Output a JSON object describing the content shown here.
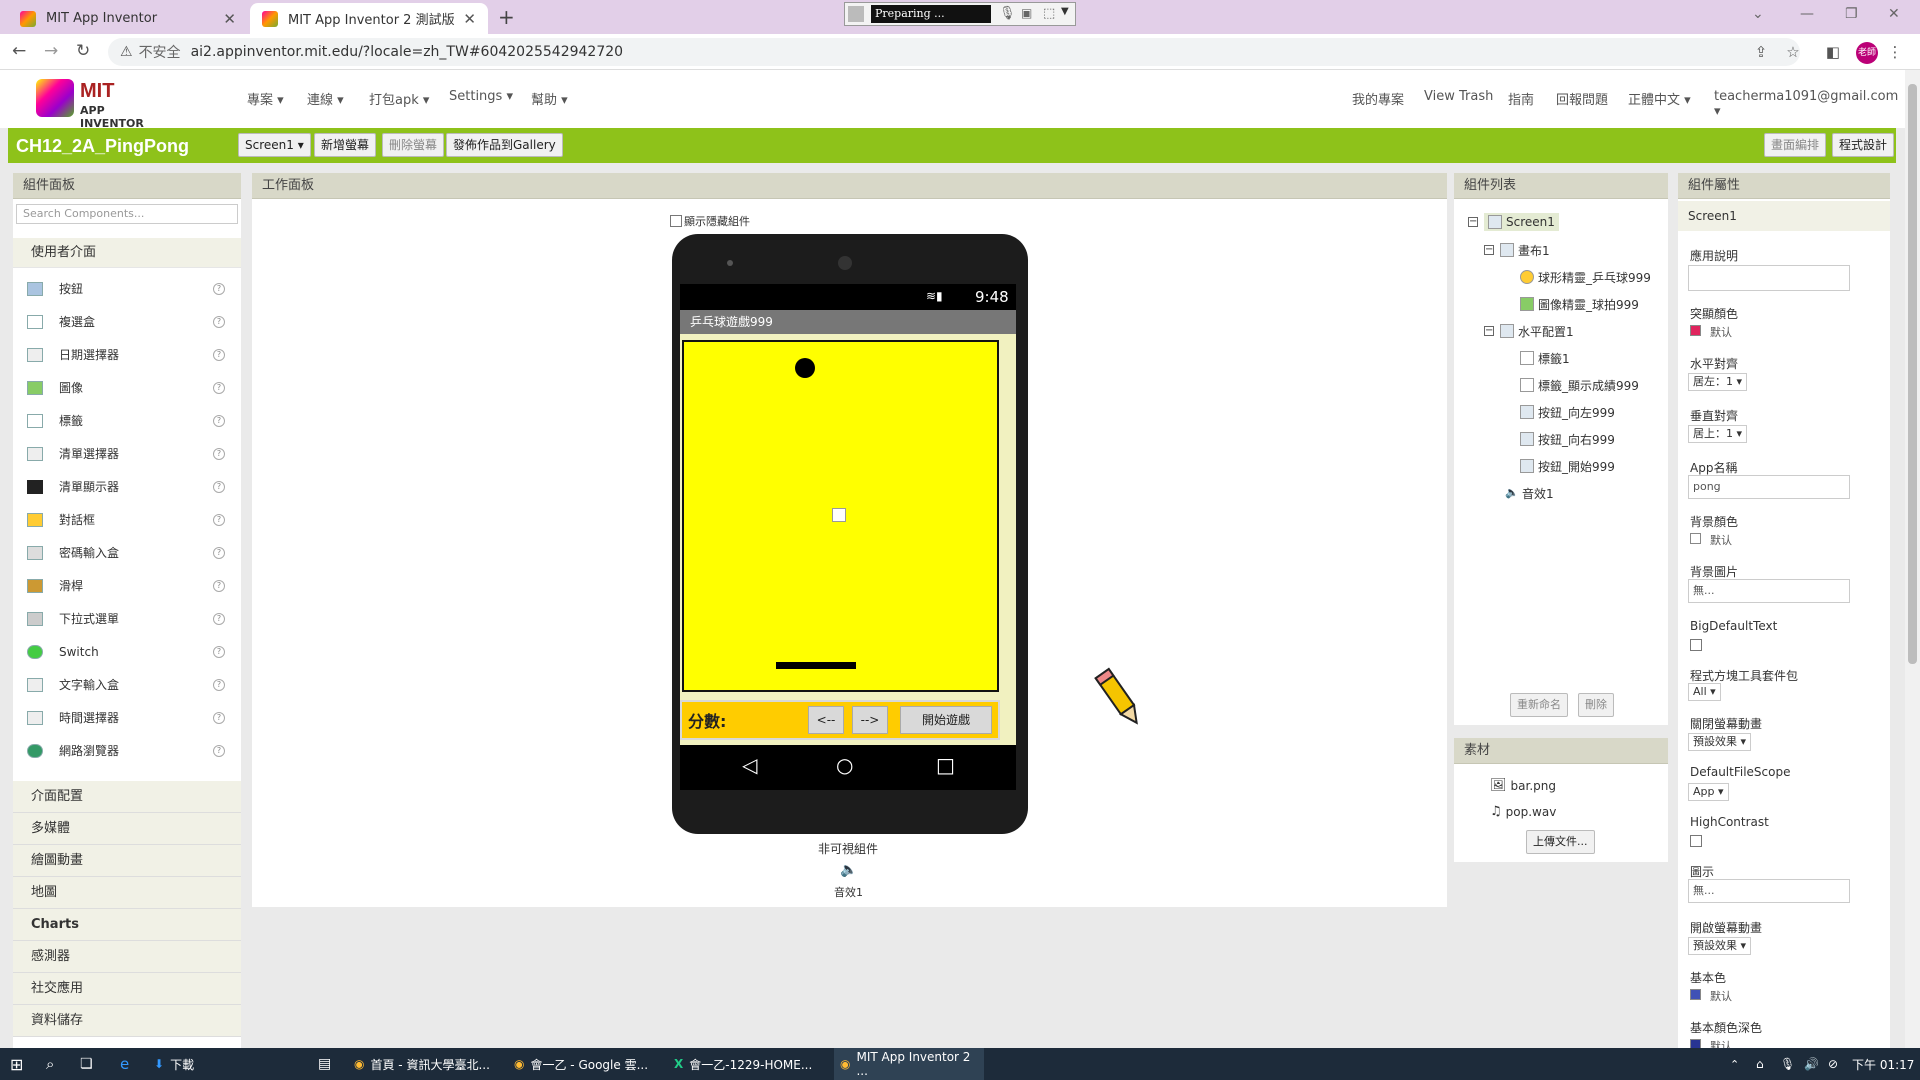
{
  "browser": {
    "tabs": [
      {
        "title": "MIT App Inventor"
      },
      {
        "title": "MIT App Inventor 2 測試版"
      }
    ],
    "recorder_status": "Preparing ...",
    "address": {
      "security": "不安全",
      "url": "ai2.appinventor.mit.edu/?locale=zh_TW#6042025542942720"
    },
    "profile_initial": "老師"
  },
  "app": {
    "logo_line1": "MIT",
    "logo_line2": "APP INVENTOR",
    "menu": [
      "專案",
      "連線",
      "打包apk",
      "Settings",
      "幫助"
    ],
    "right_menu": [
      "我的專案",
      "View Trash",
      "指南",
      "回報問題",
      "正體中文",
      "teacherma1091@gmail.com"
    ]
  },
  "toolbar": {
    "project_name": "CH12_2A_PingPong",
    "screen_select": "Screen1",
    "add_screen": "新增螢幕",
    "remove_screen": "刪除螢幕",
    "publish": "發佈作品到Gallery",
    "designer": "畫面編排",
    "blocks": "程式設計"
  },
  "palette": {
    "header": "組件面板",
    "search_placeholder": "Search Components...",
    "open_category": "使用者介面",
    "components": [
      "按鈕",
      "複選盒",
      "日期選擇器",
      "圖像",
      "標籤",
      "清單選擇器",
      "清單顯示器",
      "對話框",
      "密碼輸入盒",
      "滑桿",
      "下拉式選單",
      "Switch",
      "文字輸入盒",
      "時間選擇器",
      "網路瀏覽器"
    ],
    "help_glyph": "?",
    "categories": [
      "介面配置",
      "多媒體",
      "繪圖動畫",
      "地圖",
      "Charts",
      "感測器",
      "社交應用",
      "資料儲存"
    ]
  },
  "viewer": {
    "header": "工作面板",
    "show_hidden": "顯示隱藏組件",
    "phone_time": "9:48",
    "app_title": "乒乓球遊戲999",
    "score_label": "分數:",
    "btn_left": "<--",
    "btn_right": "-->",
    "btn_start": "開始遊戲",
    "nonvisible_label": "非可視組件",
    "nonvisible_item": "音效1"
  },
  "tree": {
    "header": "組件列表",
    "nodes": [
      {
        "label": "Screen1"
      },
      {
        "label": "畫布1"
      },
      {
        "label": "球形精靈_乒乓球999"
      },
      {
        "label": "圖像精靈_球拍999"
      },
      {
        "label": "水平配置1"
      },
      {
        "label": "標籤1"
      },
      {
        "label": "標籤_顯示成績999"
      },
      {
        "label": "按鈕_向左999"
      },
      {
        "label": "按鈕_向右999"
      },
      {
        "label": "按鈕_開始999"
      },
      {
        "label": "音效1"
      }
    ],
    "rename": "重新命名",
    "delete": "刪除"
  },
  "media": {
    "header": "素材",
    "files": [
      "bar.png",
      "pop.wav"
    ],
    "upload": "上傳文件..."
  },
  "properties": {
    "header": "組件屬性",
    "component": "Screen1",
    "about_label": "應用說明",
    "accent_label": "突顯顏色",
    "accent_value": "默认",
    "accent_color": "#e0245e",
    "halign_label": "水平對齊",
    "halign_value": "居左：1",
    "valign_label": "垂直對齊",
    "valign_value": "居上：1",
    "appname_label": "App名稱",
    "appname_value": "pong",
    "bgcolor_label": "背景顏色",
    "bgcolor_value": "默认",
    "bgimage_label": "背景圖片",
    "bgimage_value": "無...",
    "bigtext_label": "BigDefaultText",
    "blocks_toolkit_label": "程式方塊工具套件包",
    "blocks_toolkit_value": "All",
    "close_anim_label": "關閉螢幕動畫",
    "close_anim_value": "預設效果",
    "filescope_label": "DefaultFileScope",
    "filescope_value": "App",
    "highcontrast_label": "HighContrast",
    "icon_label": "圖示",
    "icon_value": "無...",
    "open_anim_label": "開啟螢幕動畫",
    "open_anim_value": "預設效果",
    "primary_label": "基本色",
    "primary_value": "默认",
    "primary_color": "#3f51b5",
    "primary_dark_label": "基本顏色深色",
    "primary_dark_value": "默认"
  },
  "taskbar": {
    "items": [
      "下載",
      "首頁 - 資訊大學臺北...",
      "會一乙 - Google 雲...",
      "會一乙-1229-HOME...",
      "MIT App Inventor 2 ..."
    ],
    "clock": "下午 01:17"
  }
}
